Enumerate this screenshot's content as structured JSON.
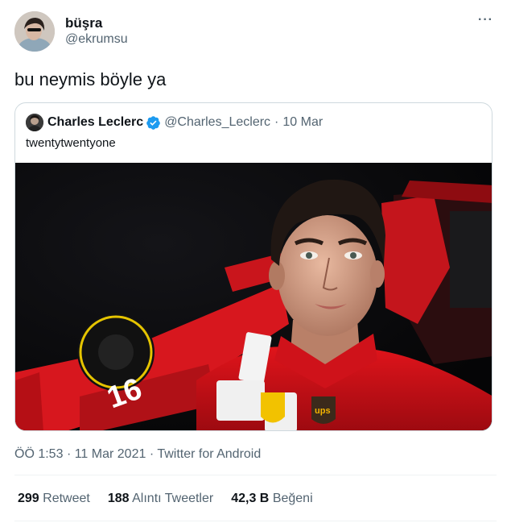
{
  "author": {
    "name": "büşra",
    "handle": "@ekrumsu"
  },
  "more_label": "···",
  "tweet_text": "bu neymis böyle ya",
  "quoted": {
    "name": "Charles Leclerc",
    "handle": "@Charles_Leclerc",
    "separator": "·",
    "date": "10 Mar",
    "text": "twentytwentyone",
    "verified_color": "#1d9bf0"
  },
  "meta": {
    "time": "ÖÖ 1:53",
    "date": "11 Mar 2021",
    "source": "Twitter for Android",
    "separator": "·"
  },
  "stats": [
    {
      "count": "299",
      "label": "Retweet"
    },
    {
      "count": "188",
      "label": "Alıntı Tweetler"
    },
    {
      "count": "42,3 B",
      "label": "Beğeni"
    }
  ],
  "media_logos": {
    "car_number": "16",
    "sponsor": "ups"
  }
}
